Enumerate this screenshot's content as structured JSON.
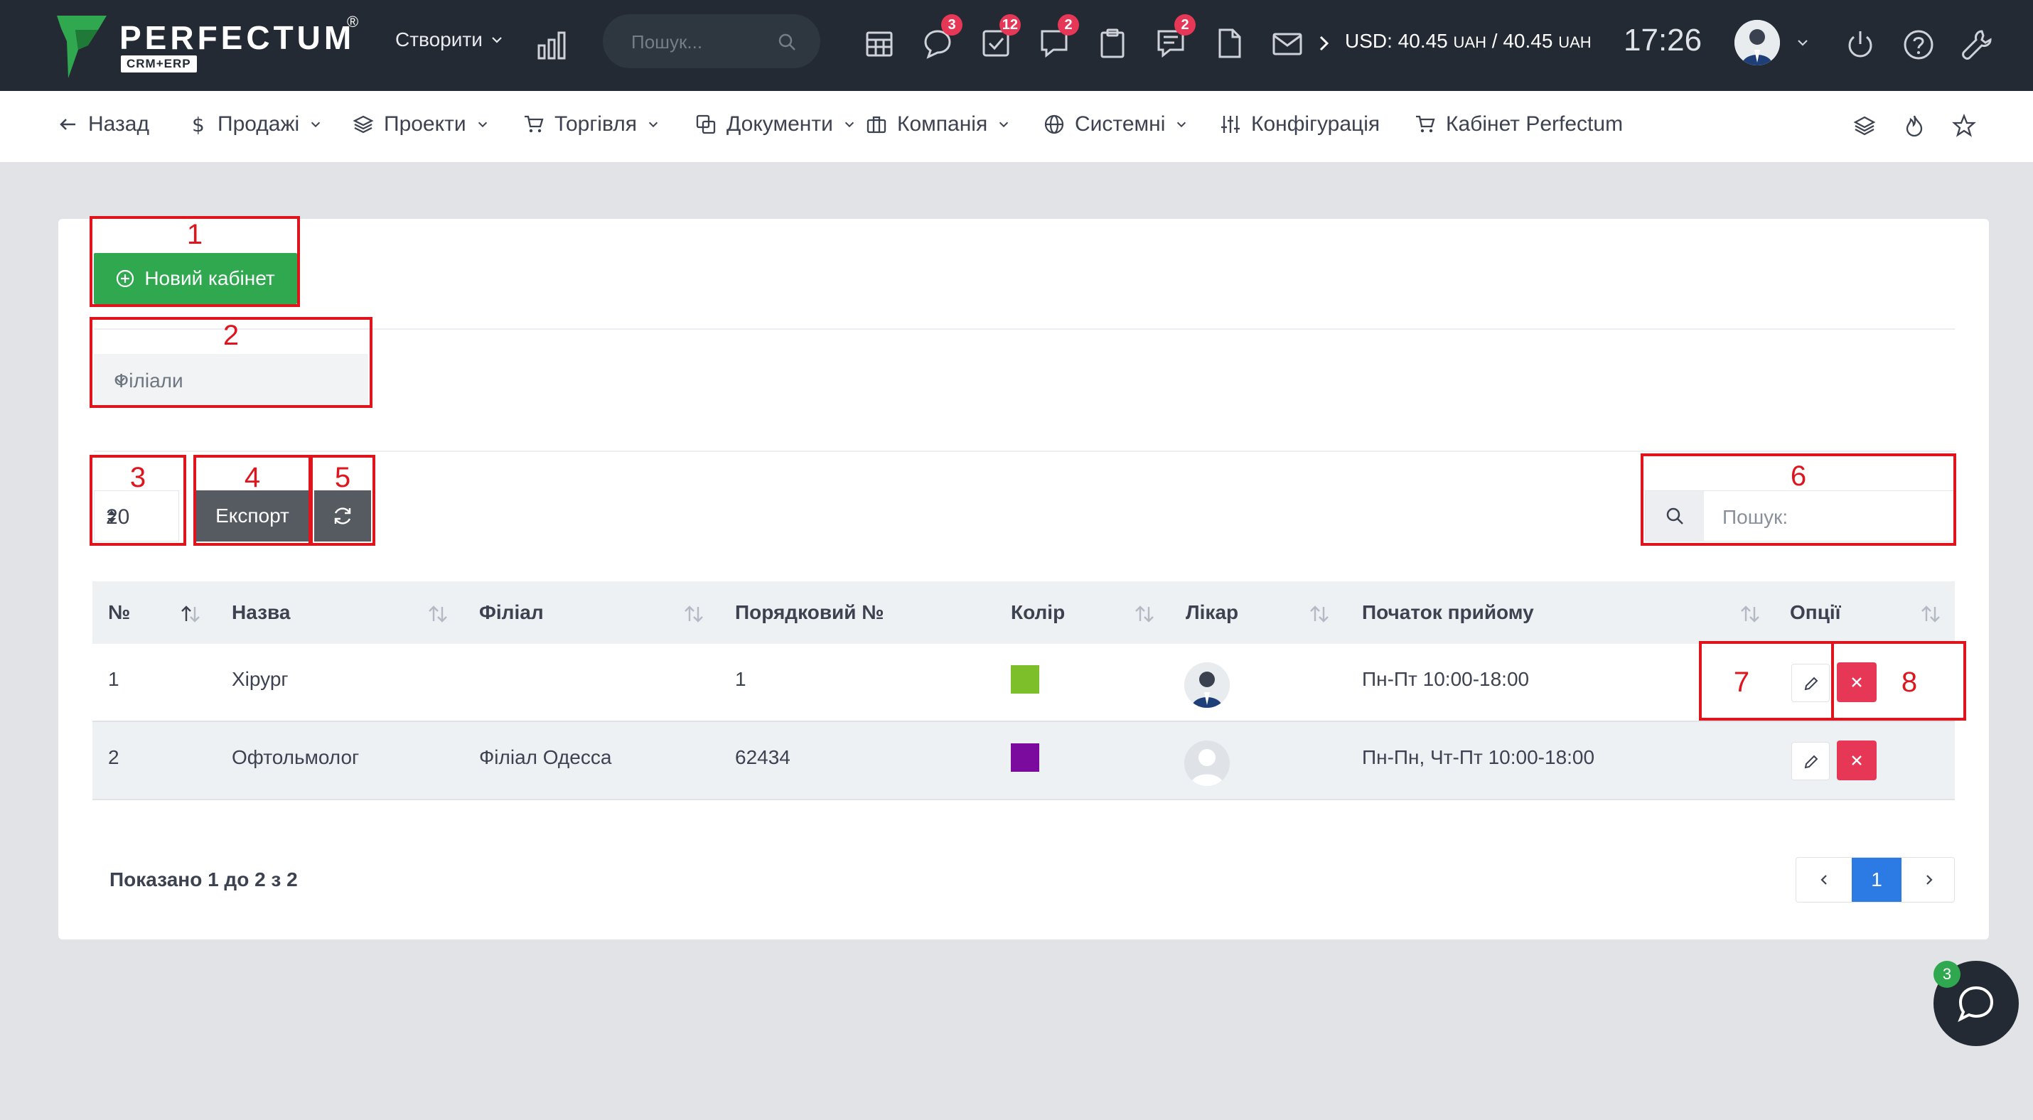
{
  "topbar": {
    "logo": {
      "word": "PERFECTUM",
      "reg": "®",
      "sub": "CRM+ERP"
    },
    "create_label": "Створити",
    "search_placeholder": "Пошук...",
    "icons": [
      {
        "name": "calendar-icon",
        "badge": ""
      },
      {
        "name": "chat-bubble-icon",
        "badge": "3"
      },
      {
        "name": "tasks-check-icon",
        "badge": "12"
      },
      {
        "name": "discussion-icon",
        "badge": "2"
      },
      {
        "name": "clipboard-icon",
        "badge": ""
      },
      {
        "name": "notes-icon",
        "badge": "2"
      },
      {
        "name": "file-icon",
        "badge": ""
      },
      {
        "name": "mail-icon",
        "badge": ""
      }
    ],
    "currency": {
      "text": "USD: 40.45",
      "unit": "UAH",
      "sep": " / ",
      "text2": "40.45"
    },
    "time": "17:26"
  },
  "nav": {
    "back": "Назад",
    "sales": "Продажі",
    "projects": "Проекти",
    "trade": "Торгівля",
    "documents": "Документи",
    "company": "Компанія",
    "system": "Системні",
    "config": "Конфігурація",
    "cabinet": "Кабінет Perfectum"
  },
  "annotations": [
    "1",
    "2",
    "3",
    "4",
    "5",
    "6",
    "7",
    "8"
  ],
  "toolbar": {
    "new_button": "Новий кабінет",
    "branches_select": "Філіали",
    "page_length": "20",
    "export_label": "Експорт",
    "search_placeholder": "Пошук:"
  },
  "table": {
    "headers": [
      "№",
      "Назва",
      "Філіал",
      "Порядковий №",
      "Колір",
      "Лікар",
      "Початок прийому",
      "Опції"
    ],
    "rows": [
      {
        "num": "1",
        "name": "Хірург",
        "branch": "",
        "order": "1",
        "color": "#7cbf2a",
        "schedule": "Пн-Пт 10:00-18:00"
      },
      {
        "num": "2",
        "name": "Офтольмолог",
        "branch": "Філіал Одесса",
        "order": "62434",
        "color": "#7b0a9e",
        "schedule": "Пн-Пн, Чт-Пт 10:00-18:00"
      }
    ]
  },
  "footer": {
    "info": "Показано 1 до 2 з 2",
    "current_page": "1"
  },
  "chat": {
    "badge": "3"
  },
  "colors": {
    "topbar": "#232a33",
    "success": "#2fa84f",
    "danger": "#e63757",
    "primary": "#2c7be5",
    "annotation": "#e0141c"
  }
}
